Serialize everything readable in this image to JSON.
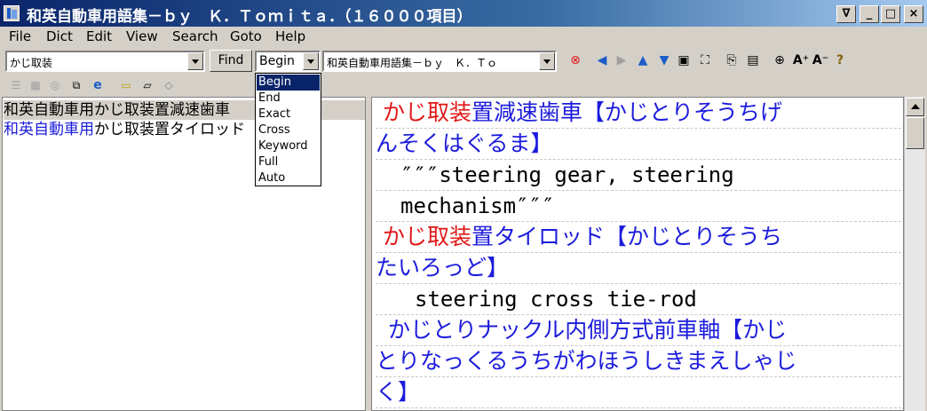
{
  "window": {
    "title": "和英自動車用語集－ｂｙ　Ｋ．Ｔｏｍｉｔａ．（１６０００項目）",
    "controls": [
      "∇",
      "_",
      "□",
      "×"
    ]
  },
  "menu": [
    "File",
    "Dict",
    "Edit",
    "View",
    "Search",
    "Goto",
    "Help"
  ],
  "toolbar": {
    "search_value": "かじ取装",
    "find_label": "Find",
    "mode_value": "Begin",
    "dict_value": "和英自動車用語集－ｂｙ　Ｋ．Ｔｏ"
  },
  "mode_options": [
    "Begin",
    "End",
    "Exact",
    "Cross",
    "Keyword",
    "Full",
    "Auto"
  ],
  "results": [
    {
      "prefix": "和英自動車用",
      "term": "かじ取装置減速歯車"
    },
    {
      "prefix": "和英自動車用",
      "term": "かじ取装置タイロッド"
    }
  ],
  "entries": {
    "e1_red": "かじ取装",
    "e1_blue": "置減速歯車【かじとりそうちげ",
    "e1_cont": "んそくはぐるま】",
    "e1_def1": "″″″steering gear, steering",
    "e1_def2": "mechanism″″″",
    "e2_red": "かじ取装",
    "e2_blue": "置タイロッド【かじとりそうち",
    "e2_cont": "たいろっど】",
    "e2_def": "steering cross tie-rod",
    "e3_line1": "かじとりナックル内側方式前車軸【かじ",
    "e3_line2": "とりなっくるうちがわほうしきまえしゃじ",
    "e3_line3": "く】"
  },
  "colors": {
    "title_start": "#0a246a",
    "headword": "#1c1cdc",
    "match": "#e01818",
    "selection": "#0a246a"
  }
}
